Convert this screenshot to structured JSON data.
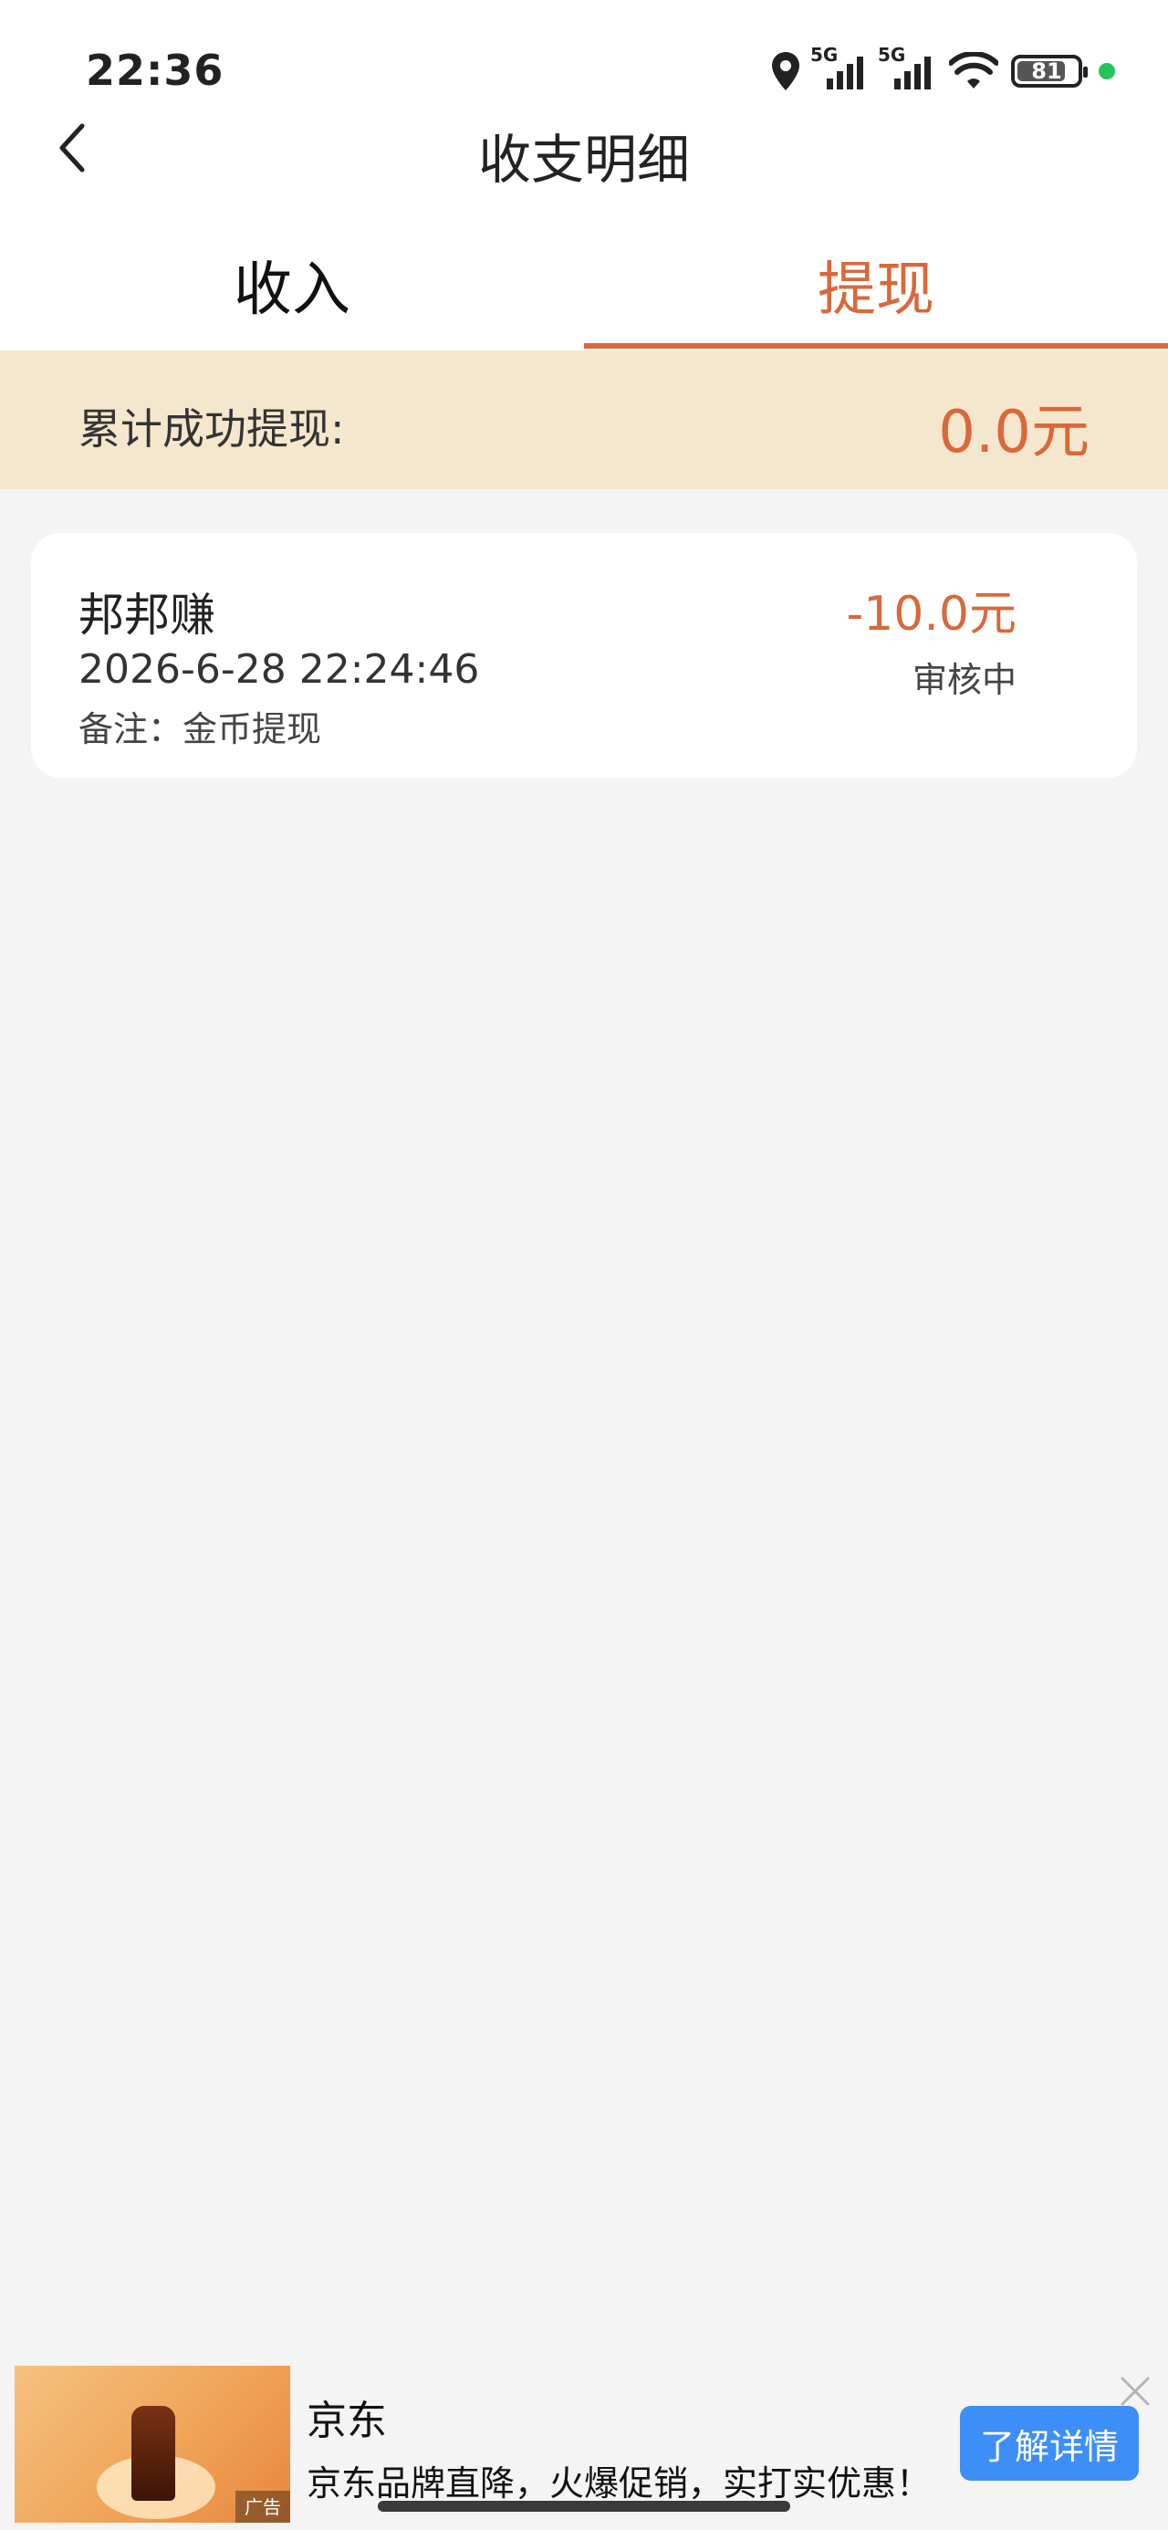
{
  "status_bar": {
    "time": "22:36",
    "network_1": "5G",
    "network_2": "5G",
    "battery": "81",
    "battery_level": 0.81,
    "icons": [
      "location-icon",
      "signal-icon",
      "signal-icon",
      "wifi-icon",
      "battery-icon"
    ]
  },
  "nav": {
    "back_icon": "chevron-left-icon",
    "title": "收支明细"
  },
  "tabs": [
    {
      "label": "收入",
      "active": false
    },
    {
      "label": "提现",
      "active": true
    }
  ],
  "summary": {
    "label": "累计成功提现:",
    "value": "0.0元"
  },
  "records": [
    {
      "title": "邦邦赚",
      "time": "2026-6-28 22:24:46",
      "note": "备注：金币提现",
      "amount": "-10.0元",
      "status": "审核中"
    }
  ],
  "ad": {
    "image_badge": "广告",
    "brand": "京东",
    "description": "京东品牌直降，火爆促销，实打实优惠！",
    "button": "了解详情",
    "close_icon": "close-icon"
  },
  "colors": {
    "accent": "#d9683a",
    "summary_bg": "#f5e7cd",
    "page_bg": "#f4f4f4",
    "ad_button": "#3d8ef7"
  }
}
